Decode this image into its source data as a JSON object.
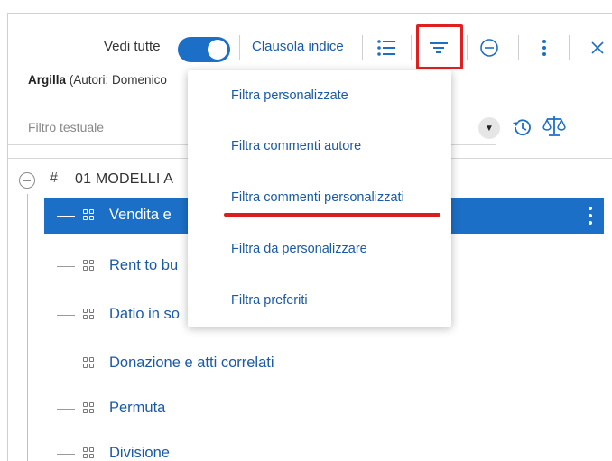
{
  "toolbar": {
    "vedi_label": "Vedi tutte",
    "toggle_on": true,
    "clausola_label": "Clausola indice",
    "icons": [
      "list-icon",
      "filter-icon",
      "minus-circle-icon",
      "kebab-icon",
      "close-icon"
    ]
  },
  "info": {
    "name": "Argilla",
    "authors": "(Autori: Domenico"
  },
  "filter": {
    "placeholder": "Filtro testuale"
  },
  "tree": {
    "root_label": "01 MODELLI A",
    "items": [
      {
        "label": "Vendita e",
        "selected": true
      },
      {
        "label": "Rent to bu",
        "selected": false
      },
      {
        "label": "Datio in so",
        "selected": false
      },
      {
        "label": "Donazione e atti correlati",
        "selected": false
      },
      {
        "label": "Permuta",
        "selected": false
      },
      {
        "label": "Divisione",
        "selected": false
      }
    ]
  },
  "menu": {
    "items": [
      "Filtra personalizzate",
      "Filtra commenti autore",
      "Filtra commenti personalizzati",
      "Filtra da personalizzare",
      "Filtra preferiti"
    ]
  },
  "colors": {
    "accent": "#1c6fc7",
    "link": "#1a5aa6",
    "highlight_red": "#e02020"
  }
}
